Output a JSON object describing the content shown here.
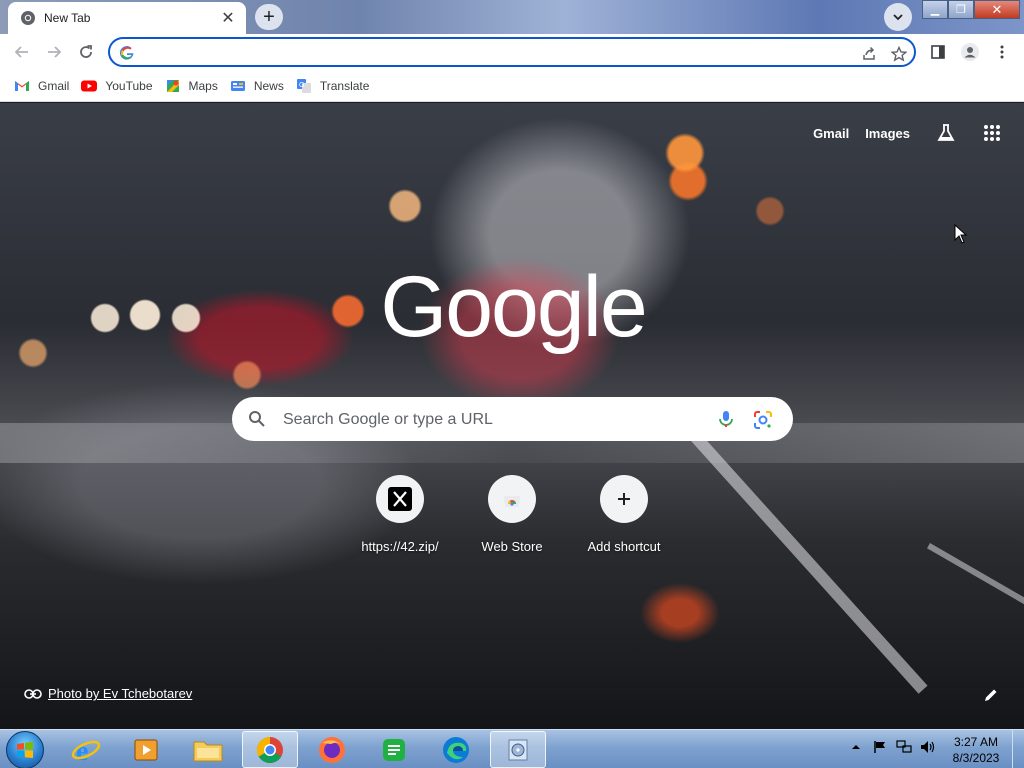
{
  "browser": {
    "tab": {
      "title": "New Tab"
    },
    "omnibox": {
      "value": "",
      "placeholder": ""
    },
    "bookmarks": [
      {
        "label": "Gmail",
        "icon": "gmail-icon"
      },
      {
        "label": "YouTube",
        "icon": "youtube-icon"
      },
      {
        "label": "Maps",
        "icon": "maps-icon"
      },
      {
        "label": "News",
        "icon": "news-icon"
      },
      {
        "label": "Translate",
        "icon": "translate-icon"
      }
    ]
  },
  "newtab": {
    "top_links": {
      "gmail": "Gmail",
      "images": "Images"
    },
    "logo": "Google",
    "search_placeholder": "Search Google or type a URL",
    "shortcuts": [
      {
        "label": "https://42.zip/",
        "icon": "x-icon"
      },
      {
        "label": "Web Store",
        "icon": "web-store-icon"
      },
      {
        "label": "Add shortcut",
        "icon": "plus-icon"
      }
    ],
    "photo_credit": "Photo by Ev Tchebotarev"
  },
  "taskbar": {
    "apps": [
      {
        "name": "internet-explorer",
        "icon": "ie-icon"
      },
      {
        "name": "media-player",
        "icon": "media-player-icon"
      },
      {
        "name": "file-explorer",
        "icon": "folder-icon"
      },
      {
        "name": "chrome",
        "icon": "chrome-icon",
        "active": true
      },
      {
        "name": "firefox",
        "icon": "firefox-icon"
      },
      {
        "name": "sheets",
        "icon": "notes-icon"
      },
      {
        "name": "edge",
        "icon": "edge-icon"
      },
      {
        "name": "installer",
        "icon": "installer-icon",
        "active": true
      }
    ],
    "clock": {
      "time": "3:27 AM",
      "date": "8/3/2023"
    }
  },
  "colors": {
    "accent": "#0b57d0",
    "taskbar": "#7ea2cf"
  }
}
